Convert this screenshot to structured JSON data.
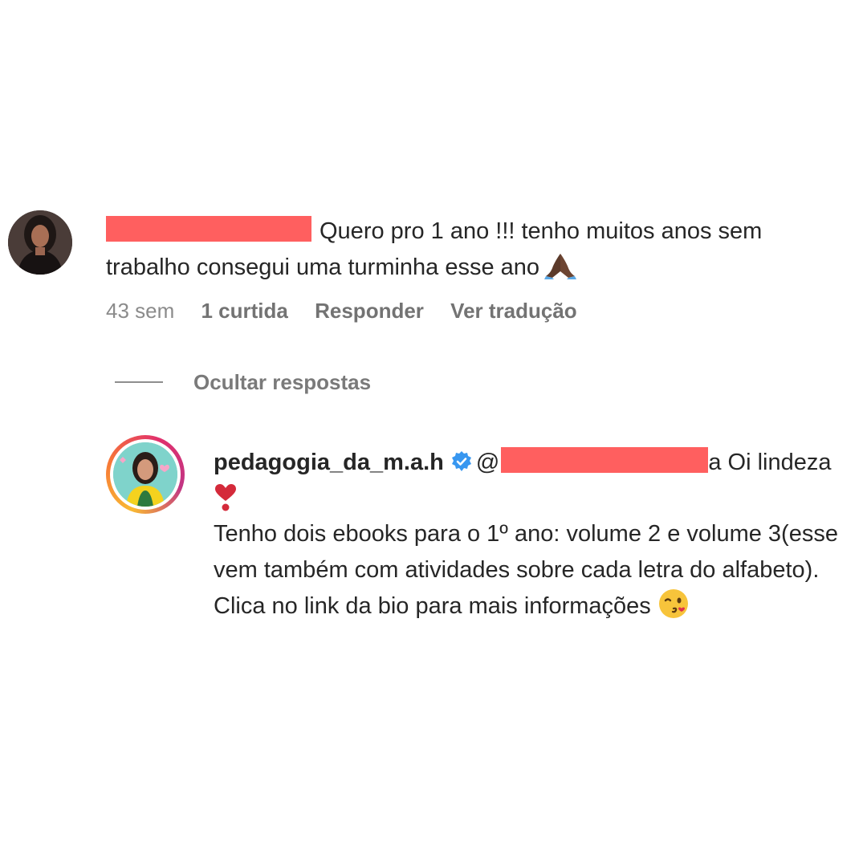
{
  "comment": {
    "text": "Quero pro 1 ano !!! tenho muitos anos sem trabalho consegui uma turminha esse ano",
    "emoji": "folded-hands",
    "time": "43 sem",
    "likes": "1 curtida",
    "reply_label": "Responder",
    "translate_label": "Ver tradução"
  },
  "replies_toggle": {
    "label": "Ocultar respostas"
  },
  "reply": {
    "username": "pedagogia_da_m.a.h",
    "mention_prefix": "@",
    "mention_tail": "a",
    "greeting": "Oi lindeza",
    "line1": "Tenho dois ebooks para o 1º ano: volume 2 e volume 3(esse vem também com atividades sobre cada letra do alfabeto).",
    "line2": "Clica no link da bio para mais informações"
  },
  "colors": {
    "redaction": "#ff5f5f",
    "verified": "#3897f0",
    "meta_text": "#7c7c7c"
  }
}
